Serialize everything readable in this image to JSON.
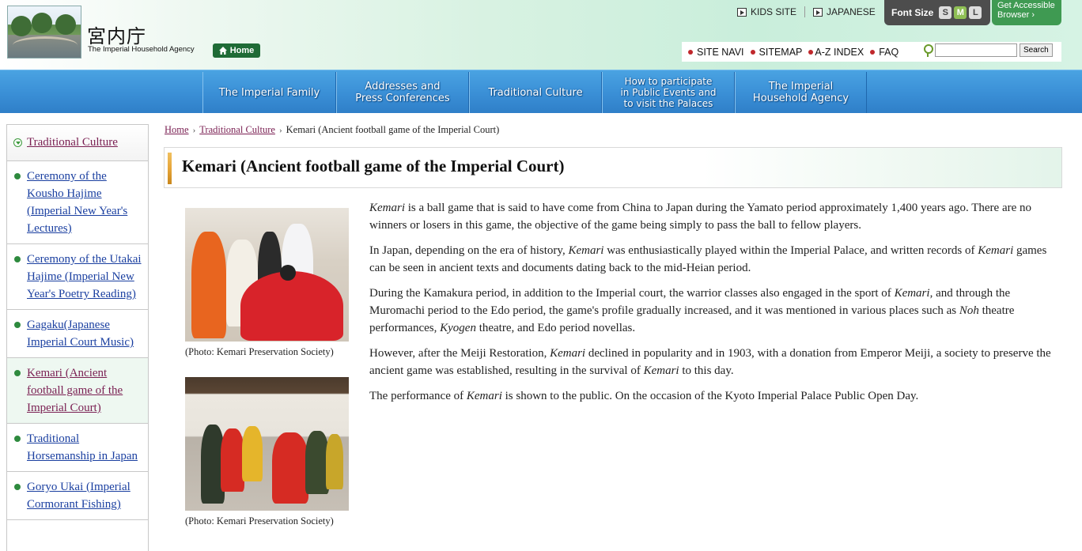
{
  "header": {
    "logo_kanji": "宮内庁",
    "logo_english": "The Imperial Household Agency",
    "home_label": "Home",
    "kids_site": "KIDS SITE",
    "japanese": "JAPANESE",
    "font_size_label": "Font Size",
    "font_sizes": [
      "S",
      "M",
      "L"
    ],
    "font_size_selected": "M",
    "accessible_line1": "Get Accessible",
    "accessible_line2": "Browser ›"
  },
  "subnav": {
    "items": [
      "SITE NAVI",
      "SITEMAP",
      "A-Z INDEX",
      "FAQ"
    ],
    "search_button": "Search",
    "search_value": ""
  },
  "mainnav": {
    "tabs": [
      {
        "label": "The Imperial Family"
      },
      {
        "label": "Addresses and\nPress Conferences"
      },
      {
        "label": "Traditional Culture"
      },
      {
        "label": "How to participate\nin Public Events and\nto visit the Palaces"
      },
      {
        "label": "The Imperial\nHousehold Agency"
      }
    ]
  },
  "sidebar": {
    "heading": "Traditional Culture",
    "items": [
      {
        "label": "Ceremony of the Kousho Hajime (Imperial New Year's Lectures)",
        "active": false
      },
      {
        "label": "Ceremony of the Utakai Hajime (Imperial New Year's Poetry Reading)",
        "active": false
      },
      {
        "label": "Gagaku(Japanese Imperial Court Music)",
        "active": false
      },
      {
        "label": "Kemari (Ancient football game of the Imperial Court)",
        "active": true
      },
      {
        "label": "Traditional Horsemanship in Japan",
        "active": false
      },
      {
        "label": "Goryo Ukai (Imperial Cormorant Fishing)",
        "active": false
      }
    ]
  },
  "breadcrumb": {
    "home": "Home",
    "section": "Traditional Culture",
    "current": "Kemari (Ancient football game of the Imperial Court)"
  },
  "page": {
    "title": "Kemari (Ancient football game of the Imperial Court)",
    "caption1": "(Photo: Kemari Preservation Society)",
    "caption2": "(Photo: Kemari Preservation Society)",
    "paragraphs": [
      [
        {
          "t": "Kemari",
          "i": true
        },
        {
          "t": " is a ball game that is said to have come from China to Japan during the Yamato period approximately 1,400 years ago. There are no winners or losers in this game, the objective of the game being simply to pass the ball to fellow players.",
          "i": false
        }
      ],
      [
        {
          "t": "In Japan, depending on the era of history, ",
          "i": false
        },
        {
          "t": "Kemari",
          "i": true
        },
        {
          "t": " was enthusiastically played within the Imperial Palace, and written records of ",
          "i": false
        },
        {
          "t": "Kemari",
          "i": true
        },
        {
          "t": " games can be seen in ancient texts and documents dating back to the mid-Heian period.",
          "i": false
        }
      ],
      [
        {
          "t": "During the Kamakura period, in addition to the Imperial court, the warrior classes also engaged in the sport of ",
          "i": false
        },
        {
          "t": "Kemari",
          "i": true
        },
        {
          "t": ", and through the Muromachi period to the Edo period, the game's profile gradually increased, and it was mentioned in various places such as ",
          "i": false
        },
        {
          "t": "Noh",
          "i": true
        },
        {
          "t": " theatre performances, ",
          "i": false
        },
        {
          "t": "Kyogen",
          "i": true
        },
        {
          "t": " theatre, and Edo period novellas.",
          "i": false
        }
      ],
      [
        {
          "t": "However, after the Meiji Restoration, ",
          "i": false
        },
        {
          "t": "Kemari",
          "i": true
        },
        {
          "t": " declined in popularity and in 1903, with a donation from Emperor Meiji, a society to preserve the ancient game was established, resulting in the survival of ",
          "i": false
        },
        {
          "t": "Kemari",
          "i": true
        },
        {
          "t": " to this day.",
          "i": false
        }
      ],
      [
        {
          "t": "The performance of ",
          "i": false
        },
        {
          "t": "Kemari",
          "i": true
        },
        {
          "t": " is shown to the public. On the occasion of the Kyoto Imperial Palace Public Open Day.",
          "i": false
        }
      ]
    ]
  },
  "colors": {
    "nav_blue": "#3a8fd6",
    "home_green": "#1f6b36",
    "accessible_green": "#3f9a52",
    "visited_link": "#7a1f52",
    "link": "#1a3fa0"
  }
}
